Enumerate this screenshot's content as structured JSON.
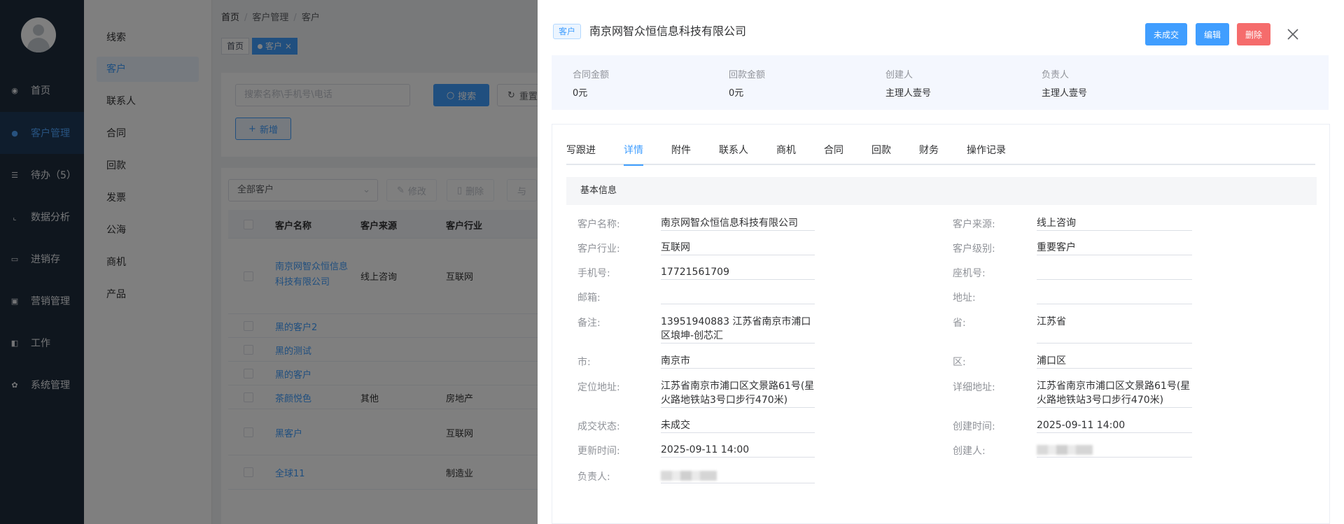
{
  "sidebar": {
    "items": [
      {
        "label": "首页",
        "icon": "dashboard-icon"
      },
      {
        "label": "客户管理",
        "icon": "users-icon",
        "active": true
      },
      {
        "label": "待办（5）",
        "icon": "todo-icon"
      },
      {
        "label": "数据分析",
        "icon": "chart-icon"
      },
      {
        "label": "进销存",
        "icon": "inventory-icon"
      },
      {
        "label": "营销管理",
        "icon": "marketing-icon"
      },
      {
        "label": "工作",
        "icon": "work-icon"
      },
      {
        "label": "系统管理",
        "icon": "gear-icon"
      }
    ]
  },
  "subnav": {
    "items": [
      "线索",
      "客户",
      "联系人",
      "合同",
      "回款",
      "发票",
      "公海",
      "商机",
      "产品"
    ],
    "active_index": 1
  },
  "breadcrumb": {
    "home": "首页",
    "section": "客户管理",
    "current": "客户"
  },
  "tags": {
    "home": "首页",
    "current": "客户",
    "close": "×"
  },
  "search": {
    "placeholder": "搜索名称\\手机号\\电话",
    "search_label": "搜索",
    "reset_label": "重置",
    "new_label": "新增"
  },
  "toolbar": {
    "filter_value": "全部客户",
    "edit_label": "修改",
    "delete_label": "删除",
    "other_label": "与"
  },
  "table": {
    "headers": [
      "客户名称",
      "客户来源",
      "客户行业"
    ],
    "rows": [
      {
        "name": "南京网智众恒信息科技有限公司",
        "source": "线上咨询",
        "industry": "互联网"
      },
      {
        "name": "黑的客户2",
        "source": "",
        "industry": ""
      },
      {
        "name": "黑的测试",
        "source": "",
        "industry": ""
      },
      {
        "name": "黑的客户",
        "source": "",
        "industry": ""
      },
      {
        "name": "茶颜悦色",
        "source": "其他",
        "industry": "房地产"
      },
      {
        "name": "黑客户",
        "source": "",
        "industry": "互联网"
      },
      {
        "name": "全球11",
        "source": "",
        "industry": "制造业"
      }
    ]
  },
  "drawer": {
    "tag": "客户",
    "title": "南京网智众恒信息科技有限公司",
    "buttons": {
      "status": "未成交",
      "edit": "编辑",
      "delete": "删除"
    },
    "stats": [
      {
        "label": "合同金额",
        "value": "0元"
      },
      {
        "label": "回款金额",
        "value": "0元"
      },
      {
        "label": "创建人",
        "value": "主理人壹号"
      },
      {
        "label": "负责人",
        "value": "主理人壹号"
      }
    ],
    "tabs": [
      "写跟进",
      "详情",
      "附件",
      "联系人",
      "商机",
      "合同",
      "回款",
      "财务",
      "操作记录"
    ],
    "active_tab": 1,
    "section_title": "基本信息",
    "fields_left": [
      {
        "label": "客户名称:",
        "value": "南京网智众恒信息科技有限公司"
      },
      {
        "label": "客户行业:",
        "value": "互联网"
      },
      {
        "label": "手机号:",
        "value": "17721561709"
      },
      {
        "label": "邮箱:",
        "value": ""
      },
      {
        "label": "备注:",
        "value": "13951940883 江苏省南京市浦口区埌坤-创芯汇"
      },
      {
        "label": "市:",
        "value": "南京市"
      },
      {
        "label": "定位地址:",
        "value": "江苏省南京市浦口区文景路61号(星火路地铁站3号口步行470米)"
      },
      {
        "label": "成交状态:",
        "value": "未成交"
      },
      {
        "label": "更新时间:",
        "value": "2025-09-11 14:00"
      },
      {
        "label": "负责人:",
        "value": ""
      }
    ],
    "fields_right": [
      {
        "label": "客户来源:",
        "value": "线上咨询"
      },
      {
        "label": "客户级别:",
        "value": "重要客户"
      },
      {
        "label": "座机号:",
        "value": ""
      },
      {
        "label": "地址:",
        "value": ""
      },
      {
        "label": "省:",
        "value": "江苏省"
      },
      {
        "label": "区:",
        "value": "浦口区"
      },
      {
        "label": "详细地址:",
        "value": "江苏省南京市浦口区文景路61号(星火路地铁站3号口步行470米)"
      },
      {
        "label": "创建时间:",
        "value": "2025-09-11 14:00"
      },
      {
        "label": "创建人:",
        "value": ""
      }
    ]
  },
  "colors": {
    "primary": "#409eff",
    "danger": "#f56c6c",
    "sidebar": "#1f2d3d"
  }
}
